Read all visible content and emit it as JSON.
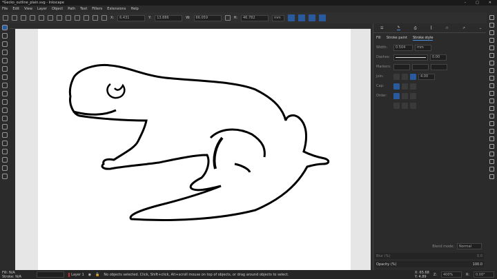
{
  "window": {
    "title": "*Gecko_outline_plain.svg - Inkscape",
    "minimize": "–",
    "maximize": "□",
    "close": "✕"
  },
  "menu": [
    "File",
    "Edit",
    "View",
    "Layer",
    "Object",
    "Path",
    "Text",
    "Filters",
    "Extensions",
    "Help"
  ],
  "toolbar": {
    "x_label": "X:",
    "x": "6.431",
    "y_label": "Y:",
    "y": "13.886",
    "w_label": "W:",
    "w": "66.059",
    "h_label": "H:",
    "h": "46.782",
    "unit": "mm"
  },
  "panel": {
    "tabs": {
      "fill": "Fill",
      "stroke_paint": "Stroke paint",
      "stroke_style": "Stroke style"
    },
    "width_label": "Width:",
    "width": "0.504",
    "width_unit": "mm",
    "dashes_label": "Dashes:",
    "dash_offset": "0.00",
    "markers_label": "Markers:",
    "join_label": "Join:",
    "miter": "4.00",
    "cap_label": "Cap:",
    "order_label": "Order:",
    "blend_label": "Blend mode:",
    "blend": "Normal",
    "blur_label": "Blur (%)",
    "blur": "0.0",
    "opacity_label": "Opacity (%)",
    "opacity": "100.0"
  },
  "status": {
    "fill_label": "Fill:",
    "fill": "N/A",
    "stroke_label": "Stroke:",
    "stroke": "N/A",
    "layer": "Layer 1",
    "message": "No objects selected. Click, Shift+click, Alt+scroll mouse on top of objects, or drag around objects to select.",
    "x_label": "X:",
    "x": "65.68",
    "y_label": "Y:",
    "y": "4.89",
    "zoom_label": "Z:",
    "zoom": "400%",
    "rot_label": "R:",
    "rotation": "0.00°"
  }
}
